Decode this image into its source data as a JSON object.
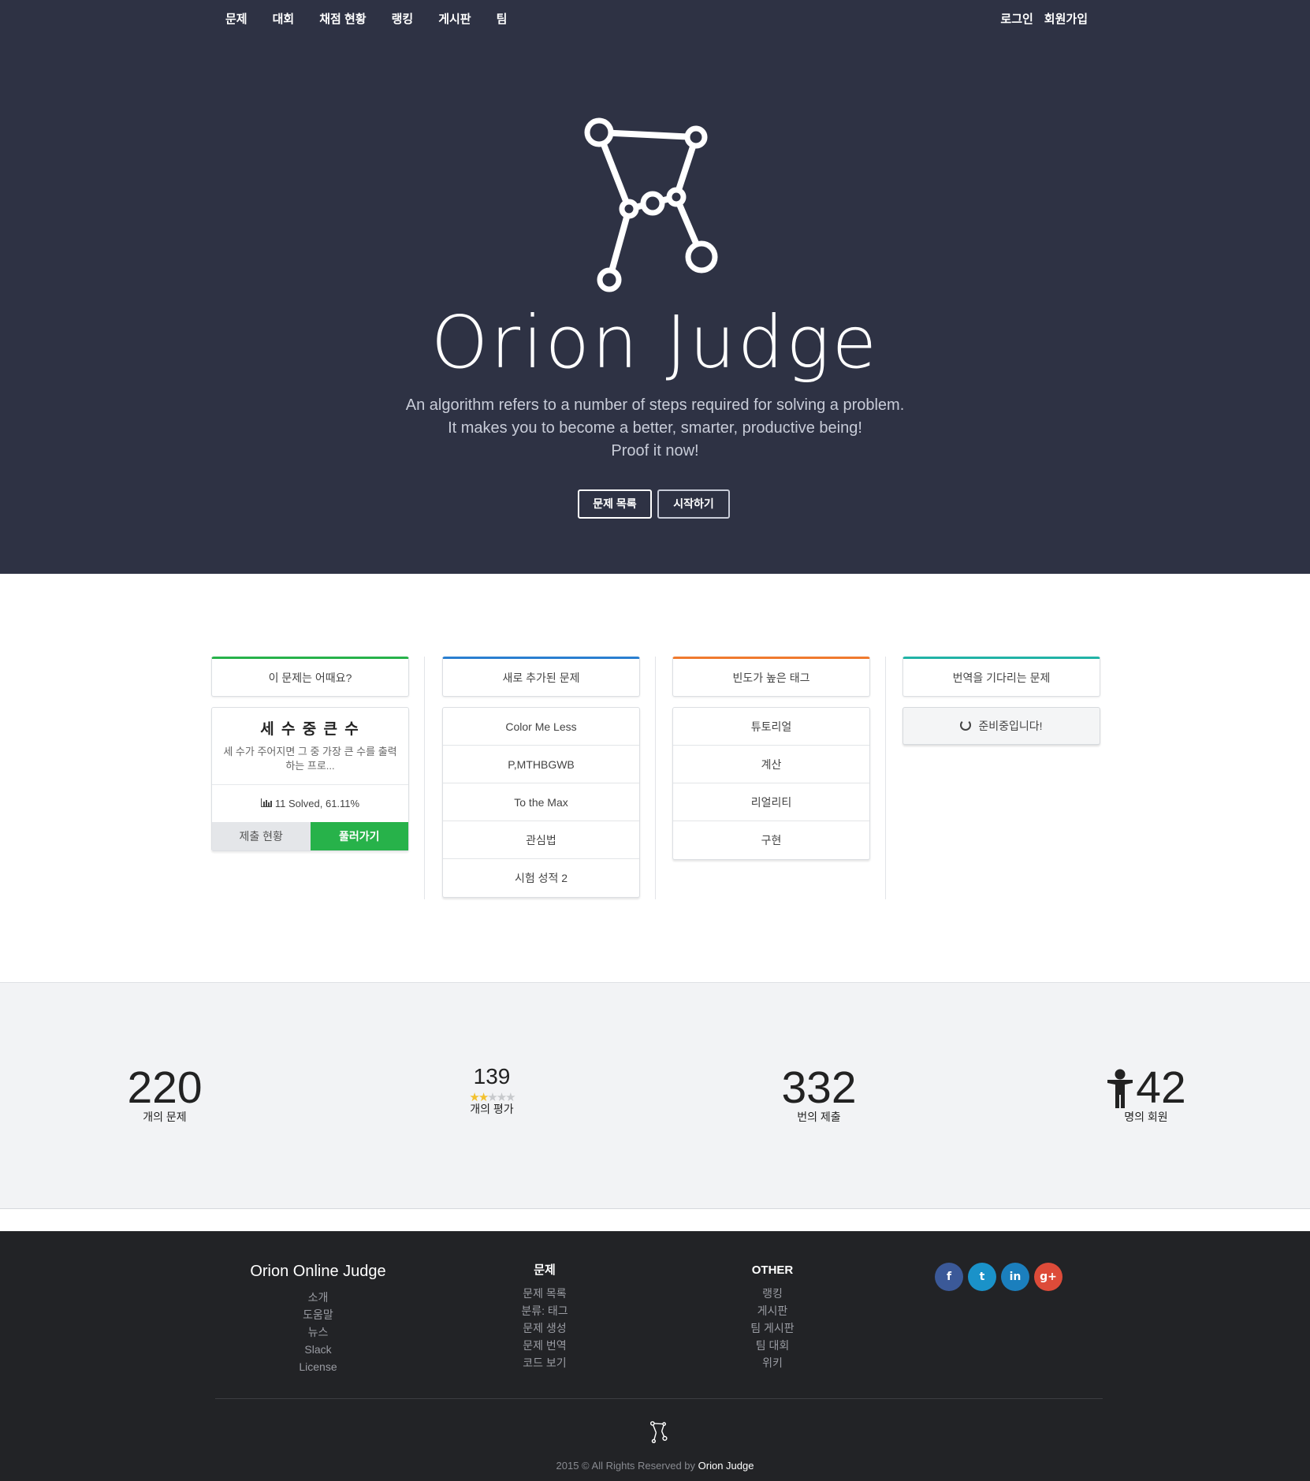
{
  "nav": {
    "left": [
      "문제",
      "대회",
      "채점 현황",
      "랭킹",
      "게시판",
      "팀"
    ],
    "login": "로그인",
    "signup": "회원가입"
  },
  "hero": {
    "title": "Orion Judge",
    "tagline": [
      "An algorithm refers to a number of steps required for solving a problem.",
      "It makes you to become a better, smarter, productive being!",
      "Proof it now!"
    ],
    "btn_problems": "문제 목록",
    "btn_start": "시작하기"
  },
  "cards": {
    "col1": {
      "header": "이 문제는 어때요?",
      "problem_title": "세 수 중 큰 수",
      "problem_desc": "세 수가 주어지면 그 중 가장 큰 수를 출력하는 프로...",
      "stats": "11 Solved, 61.11%",
      "btn_submissions": "제출 현황",
      "btn_solve": "풀러가기"
    },
    "col2": {
      "header": "새로 추가된 문제",
      "items": [
        "Color Me Less",
        "P,MTHBGWB",
        "To the Max",
        "관심법",
        "시험 성적 2"
      ]
    },
    "col3": {
      "header": "빈도가 높은 태그",
      "items": [
        "튜토리얼",
        "계산",
        "리얼리티",
        "구현"
      ]
    },
    "col4": {
      "header": "번역을 기다리는 문제",
      "pending": "준비중입니다!"
    }
  },
  "stats": {
    "problems": {
      "value": "220",
      "label": "개의 문제"
    },
    "ratings": {
      "value": "139",
      "label": "개의 평가",
      "stars_filled": 2,
      "stars_total": 5
    },
    "submissions": {
      "value": "332",
      "label": "번의 제출"
    },
    "members": {
      "value": "42",
      "label": "명의 회원"
    }
  },
  "footer": {
    "brand": "Orion Online Judge",
    "brand_links": [
      "소개",
      "도움말",
      "뉴스",
      "Slack",
      "License"
    ],
    "problems_head": "문제",
    "problems_links": [
      "문제 목록",
      "분류: 태그",
      "문제 생성",
      "문제 번역",
      "코드 보기"
    ],
    "other_head": "OTHER",
    "other_links": [
      "랭킹",
      "게시판",
      "팀 게시판",
      "팀 대회",
      "위키"
    ],
    "social": [
      "f",
      "t",
      "in",
      "g+"
    ],
    "copyright": "2015 © All Rights Reserved by",
    "copyright_brand": "Orion Judge"
  },
  "colors": {
    "hero_bg": "#2e3244",
    "green": "#27b24a",
    "blue": "#2a7fd0",
    "orange": "#f07a2e",
    "teal": "#21b3a6",
    "footer_bg": "#222326"
  }
}
